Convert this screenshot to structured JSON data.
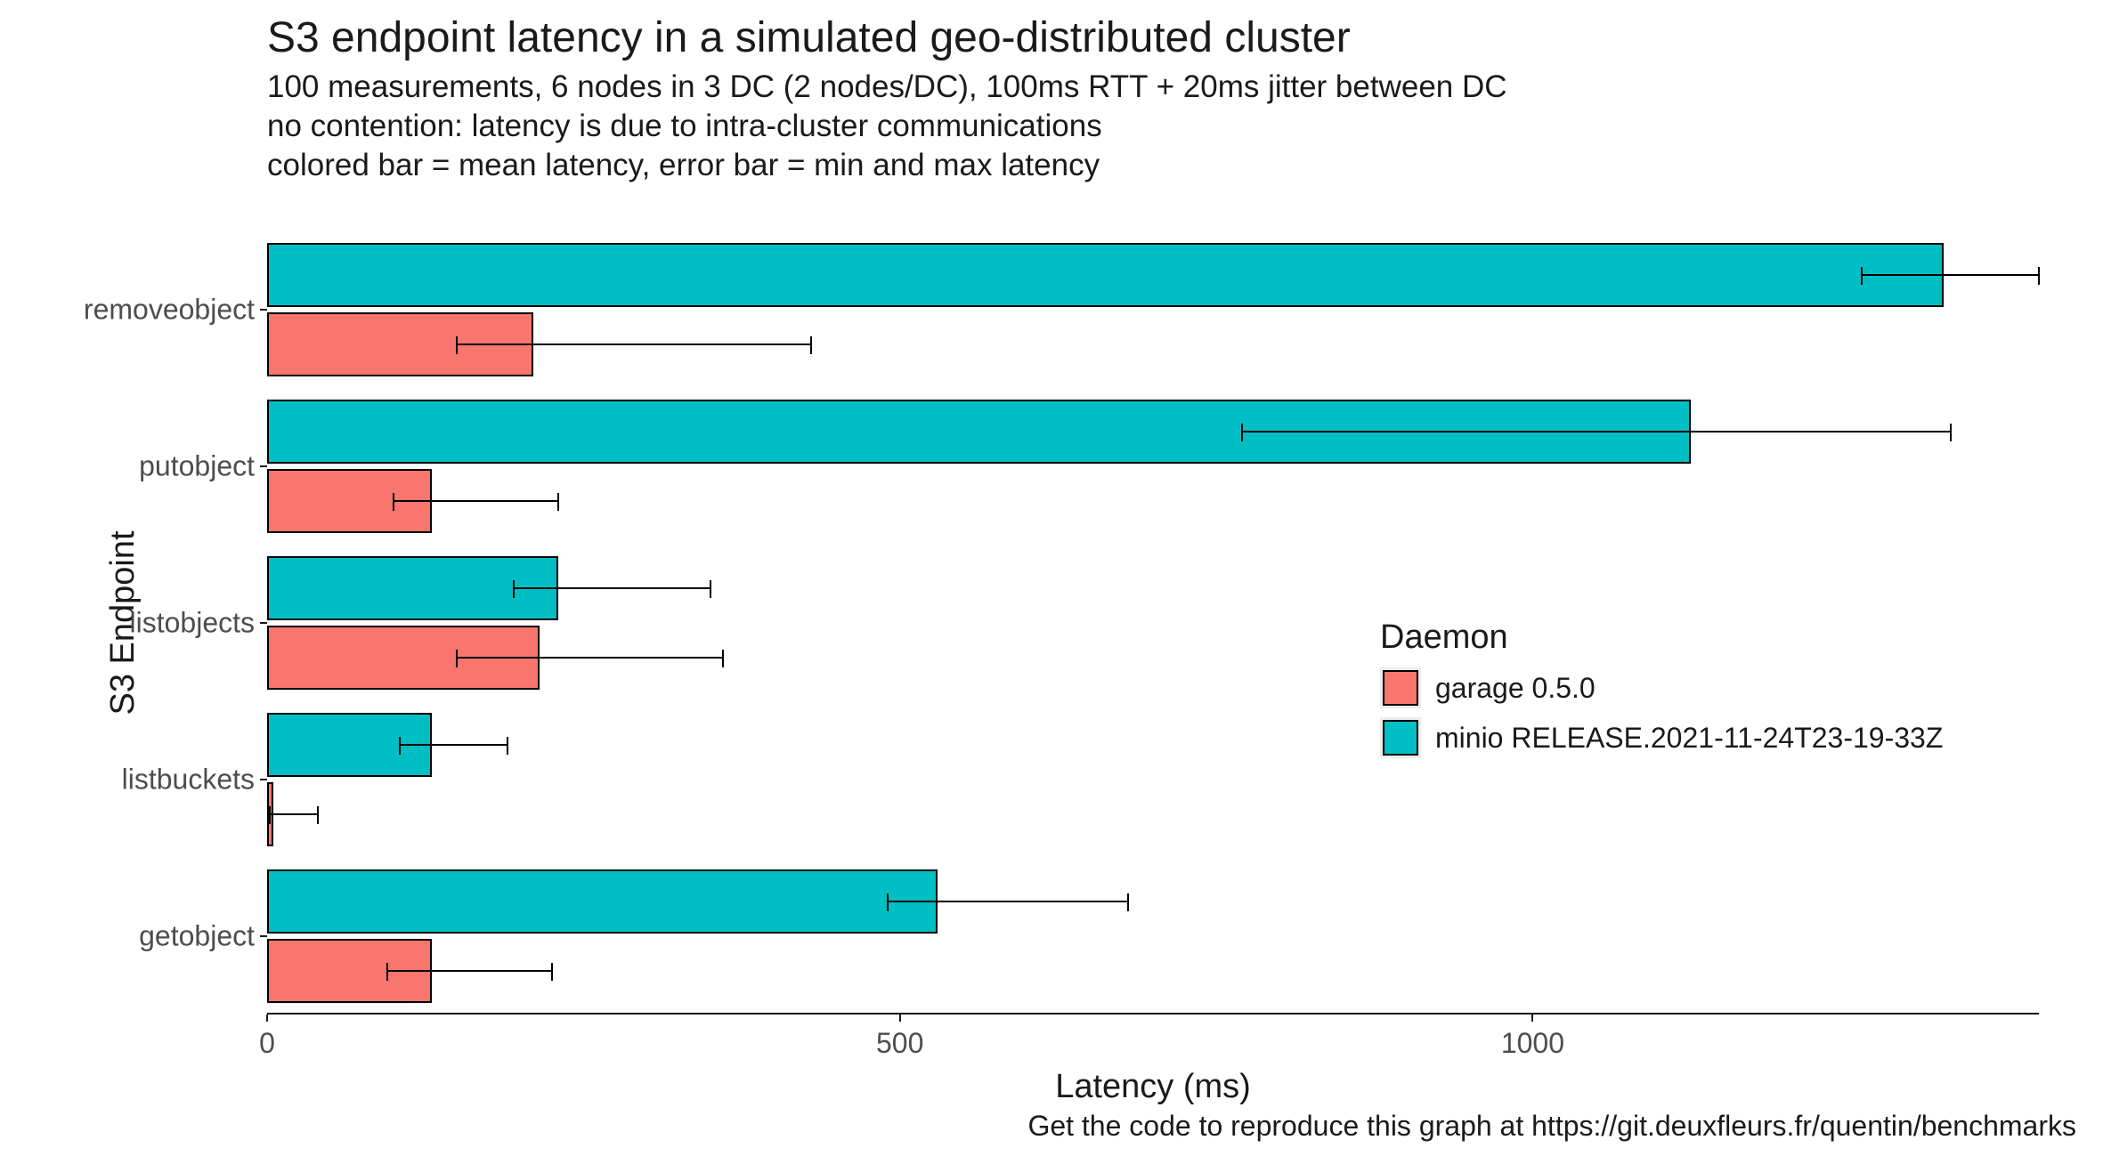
{
  "title": "S3 endpoint latency in a simulated geo-distributed cluster",
  "subtitle_line1": "100 measurements, 6 nodes in 3 DC (2 nodes/DC), 100ms RTT + 20ms jitter between DC",
  "subtitle_line2": "no contention: latency is due to intra-cluster communications",
  "subtitle_line3": "colored bar = mean latency, error bar = min and max latency",
  "xlabel": "Latency (ms)",
  "ylabel": "S3 Endpoint",
  "caption": "Get the code to reproduce this graph at https://git.deuxfleurs.fr/quentin/benchmarks",
  "legend": {
    "title": "Daemon",
    "items": [
      {
        "key": "garage",
        "label": "garage 0.5.0"
      },
      {
        "key": "minio",
        "label": "minio RELEASE.2021-11-24T23-19-33Z"
      }
    ]
  },
  "x_ticks": [
    0,
    500,
    1000
  ],
  "categories": [
    "removeobject",
    "putobject",
    "listobjects",
    "listbuckets",
    "getobject"
  ],
  "chart_data": {
    "type": "bar",
    "orientation": "horizontal",
    "title": "S3 endpoint latency in a simulated geo-distributed cluster",
    "xlabel": "Latency (ms)",
    "ylabel": "S3 Endpoint",
    "xlim": [
      0,
      1400
    ],
    "categories": [
      "removeobject",
      "putobject",
      "listobjects",
      "listbuckets",
      "getobject"
    ],
    "series": [
      {
        "name": "garage 0.5.0",
        "color": "#f8766d",
        "values": [
          210,
          130,
          215,
          5,
          130
        ],
        "err_low": [
          150,
          100,
          150,
          2,
          95
        ],
        "err_high": [
          430,
          230,
          360,
          40,
          225
        ]
      },
      {
        "name": "minio RELEASE.2021-11-24T23-19-33Z",
        "color": "#00bfc4",
        "values": [
          1325,
          1125,
          230,
          130,
          530
        ],
        "err_low": [
          1260,
          770,
          195,
          105,
          490
        ],
        "err_high": [
          1400,
          1330,
          350,
          190,
          680
        ]
      }
    ],
    "legend_title": "Daemon",
    "caption": "Get the code to reproduce this graph at https://git.deuxfleurs.fr/quentin/benchmarks",
    "subtitle": [
      "100 measurements, 6 nodes in 3 DC (2 nodes/DC), 100ms RTT + 20ms jitter between DC",
      "no contention: latency is due to intra-cluster communications",
      "colored bar = mean latency, error bar = min and max latency"
    ]
  }
}
